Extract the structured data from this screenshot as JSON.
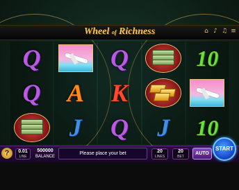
{
  "game": {
    "title_part1": "Wheel",
    "title_of": "of",
    "title_part2": "Richness"
  },
  "top_icons": [
    "home-icon",
    "music-icon",
    "sound-icon",
    "menu-icon"
  ],
  "reels": [
    [
      "Q",
      "Q",
      "money"
    ],
    [
      "plane",
      "A",
      "J"
    ],
    [
      "Q",
      "K",
      "Q"
    ],
    [
      "money",
      "gold",
      "J"
    ],
    [
      "10",
      "plane",
      "10"
    ]
  ],
  "bottom": {
    "help_label": "?",
    "bet_value": "0.01",
    "bet_label": "LINE",
    "balance_value": "500000",
    "balance_label": "BALANCE",
    "message": "Please place your bet",
    "lines_value": "20",
    "lines_label": "LINES",
    "bet_total_value": "20",
    "bet_total_label": "BET",
    "auto_label": "AUTO",
    "start_label": "START"
  }
}
